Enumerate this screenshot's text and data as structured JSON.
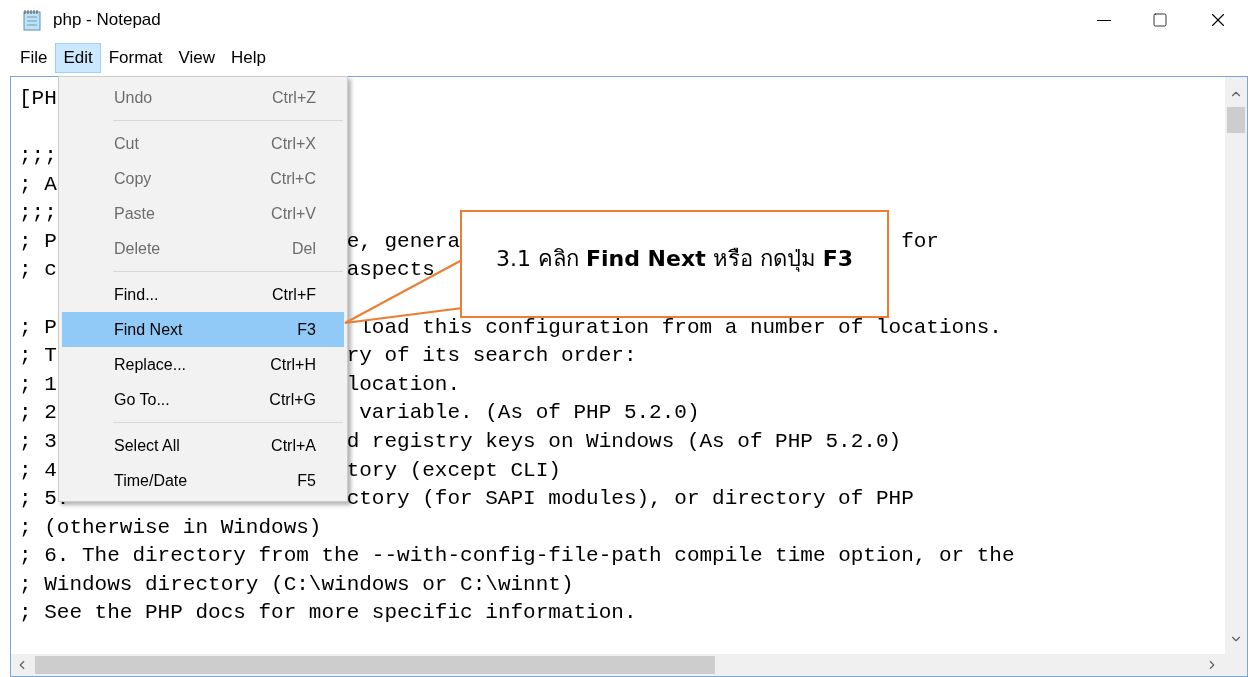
{
  "window": {
    "title": "php - Notepad"
  },
  "menubar": [
    {
      "label": "File",
      "selected": false
    },
    {
      "label": "Edit",
      "selected": true
    },
    {
      "label": "Format",
      "selected": false
    },
    {
      "label": "View",
      "selected": false
    },
    {
      "label": "Help",
      "selected": false
    }
  ],
  "edit_menu": [
    {
      "kind": "item",
      "label": "Undo",
      "shortcut": "Ctrl+Z",
      "disabled": true,
      "selected": false
    },
    {
      "kind": "separator"
    },
    {
      "kind": "item",
      "label": "Cut",
      "shortcut": "Ctrl+X",
      "disabled": true,
      "selected": false
    },
    {
      "kind": "item",
      "label": "Copy",
      "shortcut": "Ctrl+C",
      "disabled": true,
      "selected": false
    },
    {
      "kind": "item",
      "label": "Paste",
      "shortcut": "Ctrl+V",
      "disabled": true,
      "selected": false
    },
    {
      "kind": "item",
      "label": "Delete",
      "shortcut": "Del",
      "disabled": true,
      "selected": false
    },
    {
      "kind": "separator"
    },
    {
      "kind": "item",
      "label": "Find...",
      "shortcut": "Ctrl+F",
      "disabled": false,
      "selected": false
    },
    {
      "kind": "item",
      "label": "Find Next",
      "shortcut": "F3",
      "disabled": false,
      "selected": true
    },
    {
      "kind": "item",
      "label": "Replace...",
      "shortcut": "Ctrl+H",
      "disabled": false,
      "selected": false
    },
    {
      "kind": "item",
      "label": "Go To...",
      "shortcut": "Ctrl+G",
      "disabled": false,
      "selected": false
    },
    {
      "kind": "separator"
    },
    {
      "kind": "item",
      "label": "Select All",
      "shortcut": "Ctrl+A",
      "disabled": false,
      "selected": false
    },
    {
      "kind": "item",
      "label": "Time/Date",
      "shortcut": "F5",
      "disabled": false,
      "selected": false
    }
  ],
  "editor": {
    "lines": [
      {
        "kind": "split",
        "left": "[PH"
      },
      {
        "kind": "blank"
      },
      {
        "kind": "split",
        "left": ";;;"
      },
      {
        "kind": "split",
        "left": "; A"
      },
      {
        "kind": "split",
        "left": ";;;"
      },
      {
        "kind": "split",
        "left": "; P",
        "right": "e, genera",
        "far": "for"
      },
      {
        "kind": "split",
        "left": "; c",
        "right": "aspects"
      },
      {
        "kind": "blank"
      },
      {
        "kind": "split",
        "left": "; P",
        "right": " load this configuration from a number of locations."
      },
      {
        "kind": "split",
        "left": "; T",
        "right": "ry of its search order:"
      },
      {
        "kind": "split",
        "left": "; 1",
        "right": "location."
      },
      {
        "kind": "split",
        "left": "; 2",
        "right": " variable. (As of PHP 5.2.0)"
      },
      {
        "kind": "split",
        "left": "; 3",
        "right": "d registry keys on Windows (As of PHP 5.2.0)"
      },
      {
        "kind": "split",
        "left": "; 4",
        "right": "tory (except CLI)"
      },
      {
        "kind": "split",
        "left": "; 5.",
        "right": "ctory (for SAPI modules), or directory of PHP"
      },
      {
        "kind": "full",
        "text": "; (otherwise in Windows)"
      },
      {
        "kind": "full",
        "text": "; 6. The directory from the --with-config-file-path compile time option, or the"
      },
      {
        "kind": "full",
        "text": "; Windows directory (C:\\windows or C:\\winnt)"
      },
      {
        "kind": "full",
        "text": "; See the PHP docs for more specific information."
      }
    ]
  },
  "callout": {
    "text": "3.1 คลิก **Find Next** หรือ กดปุ่ม **F3**"
  }
}
